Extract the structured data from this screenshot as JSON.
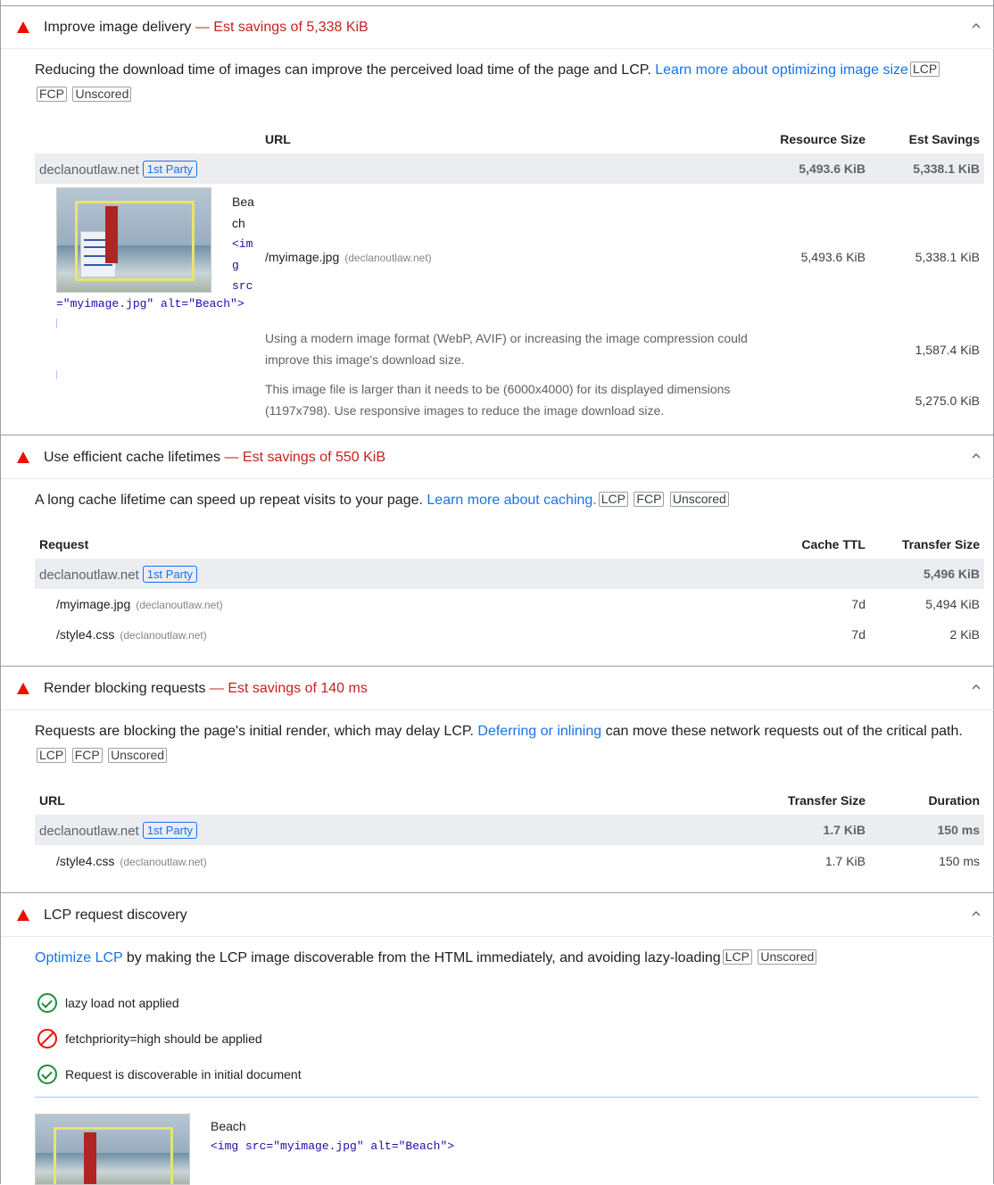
{
  "audits": {
    "image_delivery": {
      "title": "Improve image delivery",
      "savings": " — Est savings of 5,338 KiB",
      "description": "Reducing the download time of images can improve the perceived load time of the page and LCP.",
      "link": "Learn more about optimizing image size",
      "tags": [
        "LCP",
        "FCP",
        "Unscored"
      ],
      "columns": [
        "URL",
        "Resource Size",
        "Est Savings"
      ],
      "group": {
        "name": "declanoutlaw.net",
        "party": "1st Party",
        "resource_size": "5,493.6 KiB",
        "savings": "5,338.1 KiB"
      },
      "node_label_lines": [
        "Bea",
        "ch"
      ],
      "node_code_lines": [
        "<im",
        "g",
        "src"
      ],
      "node_code_tail": "=\"myimage.jpg\" alt=\"Beach\">",
      "row": {
        "url": "/myimage.jpg",
        "origin": "(declanoutlaw.net)",
        "resource_size": "5,493.6 KiB",
        "savings": "5,338.1 KiB"
      },
      "subitems": [
        {
          "text": "Using a modern image format (WebP, AVIF) or increasing the image compression could improve this image's download size.",
          "savings": "1,587.4 KiB"
        },
        {
          "text": "This image file is larger than it needs to be (6000x4000) for its displayed dimensions (1197x798). Use responsive images to reduce the image download size.",
          "savings": "5,275.0 KiB"
        }
      ]
    },
    "cache": {
      "title": "Use efficient cache lifetimes",
      "savings": " — Est savings of 550 KiB",
      "description": "A long cache lifetime can speed up repeat visits to your page.",
      "link": "Learn more about caching.",
      "tags": [
        "LCP",
        "FCP",
        "Unscored"
      ],
      "columns": [
        "Request",
        "Cache TTL",
        "Transfer Size"
      ],
      "group": {
        "name": "declanoutlaw.net",
        "party": "1st Party",
        "transfer_size": "5,496 KiB"
      },
      "rows": [
        {
          "url": "/myimage.jpg",
          "origin": "(declanoutlaw.net)",
          "ttl": "7d",
          "size": "5,494 KiB"
        },
        {
          "url": "/style4.css",
          "origin": "(declanoutlaw.net)",
          "ttl": "7d",
          "size": "2 KiB"
        }
      ]
    },
    "render_blocking": {
      "title": "Render blocking requests",
      "savings": " — Est savings of 140 ms",
      "description_before": "Requests are blocking the page's initial render, which may delay LCP.",
      "link": "Deferring or inlining",
      "description_after": "can move these network requests out of the critical path.",
      "tags": [
        "LCP",
        "FCP",
        "Unscored"
      ],
      "columns": [
        "URL",
        "Transfer Size",
        "Duration"
      ],
      "group": {
        "name": "declanoutlaw.net",
        "party": "1st Party",
        "transfer_size": "1.7 KiB",
        "duration": "150 ms"
      },
      "row": {
        "url": "/style4.css",
        "origin": "(declanoutlaw.net)",
        "transfer_size": "1.7 KiB",
        "duration": "150 ms"
      }
    },
    "lcp_discovery": {
      "title": "LCP request discovery",
      "link": "Optimize LCP",
      "description": "by making the LCP image discoverable from the HTML immediately, and avoiding lazy-loading",
      "tags": [
        "LCP",
        "Unscored"
      ],
      "checks": [
        {
          "label": "lazy load not applied",
          "status": "pass"
        },
        {
          "label": "fetchpriority=high should be applied",
          "status": "fail"
        },
        {
          "label": "Request is discoverable in initial document",
          "status": "pass"
        }
      ],
      "node_label": "Beach",
      "node_code": "<img src=\"myimage.jpg\" alt=\"Beach\">"
    }
  },
  "colors": {
    "fail": "#eb0f00",
    "savings_text": "#c5221f",
    "link": "#1a73e8",
    "pass": "#1e8e3e"
  }
}
